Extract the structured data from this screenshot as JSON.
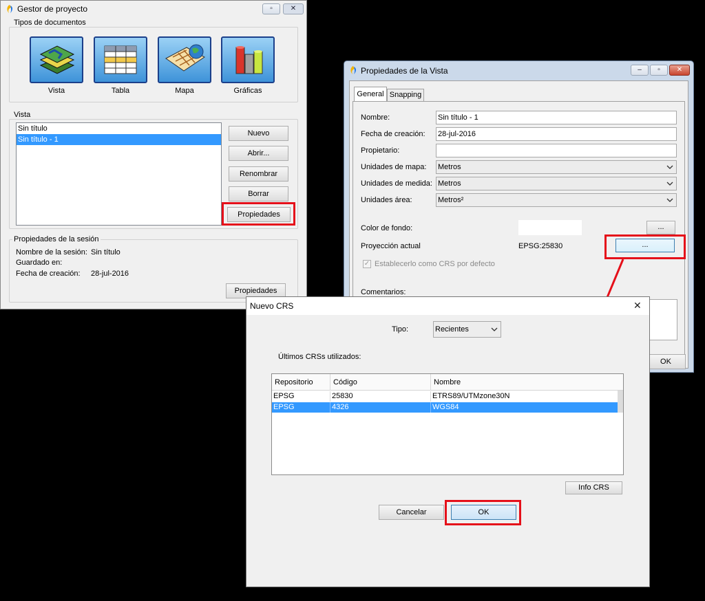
{
  "gestor": {
    "title": "Gestor de proyecto",
    "doc_types_label": "Tipos de documentos",
    "doc_types": [
      {
        "label": "Vista",
        "icon": "vista-icon"
      },
      {
        "label": "Tabla",
        "icon": "tabla-icon"
      },
      {
        "label": "Mapa",
        "icon": "mapa-icon"
      },
      {
        "label": "Gráficas",
        "icon": "graficas-icon"
      }
    ],
    "vista_label": "Vista",
    "vista_items": [
      "Sin título",
      "Sin título - 1"
    ],
    "selected_index": 1,
    "buttons": {
      "new": "Nuevo",
      "open": "Abrir...",
      "rename": "Renombrar",
      "delete": "Borrar",
      "properties": "Propiedades"
    },
    "session": {
      "label": "Propiedades de la sesión",
      "name_label": "Nombre de la sesión:",
      "name_value": "Sin título",
      "saved_label": "Guardado en:",
      "saved_value": "",
      "date_label": "Fecha de creación:",
      "date_value": "28-jul-2016",
      "properties_button": "Propiedades"
    }
  },
  "vista_props": {
    "title": "Propiedades de la Vista",
    "tabs": [
      "General",
      "Snapping"
    ],
    "active_tab": "General",
    "fields": {
      "name_label": "Nombre:",
      "name_value": "Sin título - 1",
      "date_label": "Fecha de creación:",
      "date_value": "28-jul-2016",
      "owner_label": "Propietario:",
      "owner_value": "",
      "map_units_label": "Unidades de mapa:",
      "map_units_value": "Metros",
      "measure_units_label": "Unidades de medida:",
      "measure_units_value": "Metros",
      "area_units_label": "Unidades área:",
      "area_units_value": "Metros²",
      "bg_color_label": "Color de fondo:",
      "bg_color_value": "#ffffff",
      "projection_label": "Proyección actual",
      "projection_value": "EPSG:25830",
      "default_crs_label": "Establecerlo como CRS por defecto",
      "comments_label": "Comentarios:"
    },
    "ellipsis": "...",
    "ok_button": "OK"
  },
  "nuevo_crs": {
    "title": "Nuevo CRS",
    "close_glyph": "✕",
    "tipo_label": "Tipo:",
    "tipo_value": "Recientes",
    "recent_label": "Últimos CRSs utilizados:",
    "columns": [
      "Repositorio",
      "Código",
      "Nombre"
    ],
    "rows": [
      [
        "EPSG",
        "25830",
        "ETRS89/UTMzone30N"
      ],
      [
        "EPSG",
        "4326",
        "WGS84"
      ]
    ],
    "selected_row": 1,
    "info_button": "Info CRS",
    "cancel_button": "Cancelar",
    "ok_button": "OK"
  },
  "colors": {
    "highlight": "#e5101a",
    "selection": "#3399ff",
    "window_bg": "#f0f0f0"
  }
}
